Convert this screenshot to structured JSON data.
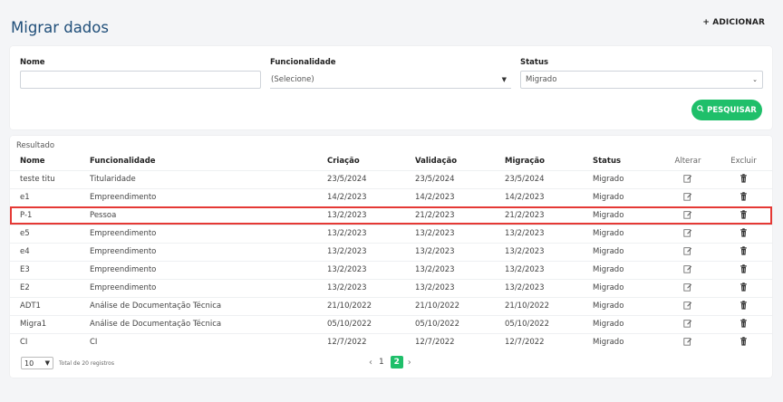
{
  "header": {
    "title": "Migrar dados",
    "add_label": "+ ADICIONAR"
  },
  "filters": {
    "nome": {
      "label": "Nome",
      "value": ""
    },
    "funcionalidade": {
      "label": "Funcionalidade",
      "value": "(Selecione)"
    },
    "status": {
      "label": "Status",
      "value": "Migrado"
    },
    "search_label": "PESQUISAR"
  },
  "results": {
    "title": "Resultado",
    "columns": [
      "Nome",
      "Funcionalidade",
      "Criação",
      "Validação",
      "Migração",
      "Status",
      "Alterar",
      "Excluir"
    ],
    "rows": [
      [
        "teste titu",
        "Titularidade",
        "23/5/2024",
        "23/5/2024",
        "23/5/2024",
        "Migrado"
      ],
      [
        "e1",
        "Empreendimento",
        "14/2/2023",
        "14/2/2023",
        "14/2/2023",
        "Migrado"
      ],
      [
        "P-1",
        "Pessoa",
        "13/2/2023",
        "21/2/2023",
        "21/2/2023",
        "Migrado"
      ],
      [
        "e5",
        "Empreendimento",
        "13/2/2023",
        "13/2/2023",
        "13/2/2023",
        "Migrado"
      ],
      [
        "e4",
        "Empreendimento",
        "13/2/2023",
        "13/2/2023",
        "13/2/2023",
        "Migrado"
      ],
      [
        "E3",
        "Empreendimento",
        "13/2/2023",
        "13/2/2023",
        "13/2/2023",
        "Migrado"
      ],
      [
        "E2",
        "Empreendimento",
        "13/2/2023",
        "13/2/2023",
        "13/2/2023",
        "Migrado"
      ],
      [
        "ADT1",
        "Análise de Documentação Técnica",
        "21/10/2022",
        "21/10/2022",
        "21/10/2022",
        "Migrado"
      ],
      [
        "Migra1",
        "Análise de Documentação Técnica",
        "05/10/2022",
        "05/10/2022",
        "05/10/2022",
        "Migrado"
      ],
      [
        "CI",
        "CI",
        "12/7/2022",
        "12/7/2022",
        "12/7/2022",
        "Migrado"
      ]
    ],
    "highlighted_row": 2
  },
  "pagination": {
    "page_size": "10",
    "total_text": "Total de 20 registros",
    "pages": [
      "1",
      "2"
    ],
    "current_page": "2"
  },
  "colors": {
    "accent": "#1fbf6a",
    "title": "#1f4e79",
    "highlight": "#e53935"
  }
}
